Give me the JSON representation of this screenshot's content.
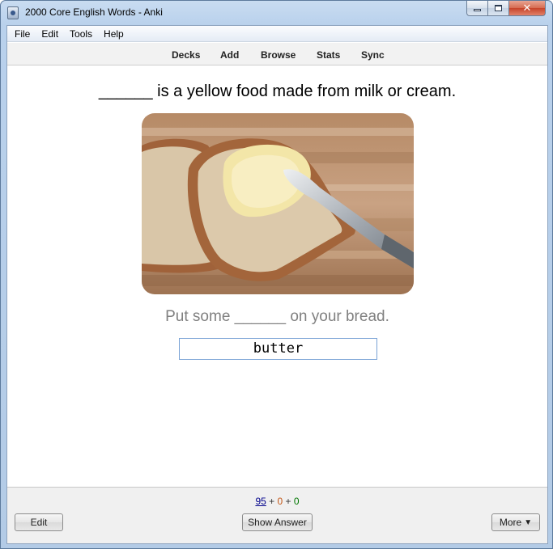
{
  "window": {
    "title": "2000 Core English Words - Anki",
    "controls": {
      "minimize": "▭",
      "maximize": "□",
      "close": "✕"
    }
  },
  "menu": [
    "File",
    "Edit",
    "Tools",
    "Help"
  ],
  "toolbar": [
    "Decks",
    "Add",
    "Browse",
    "Stats",
    "Sync"
  ],
  "card": {
    "question": "______ is a yellow food made from milk or cream.",
    "image_subject": "bread-with-butter-and-knife",
    "sentence": "Put some ______ on your bread.",
    "answer_value": "butter"
  },
  "counts": {
    "new": "95",
    "plus1": " + ",
    "learning": "0",
    "plus2": " + ",
    "review": "0"
  },
  "buttons": {
    "edit": "Edit",
    "show_answer": "Show Answer",
    "more": "More",
    "more_caret": "▼"
  },
  "colors": {
    "new": "#00008b",
    "learning": "#c35617",
    "review": "#007700"
  }
}
